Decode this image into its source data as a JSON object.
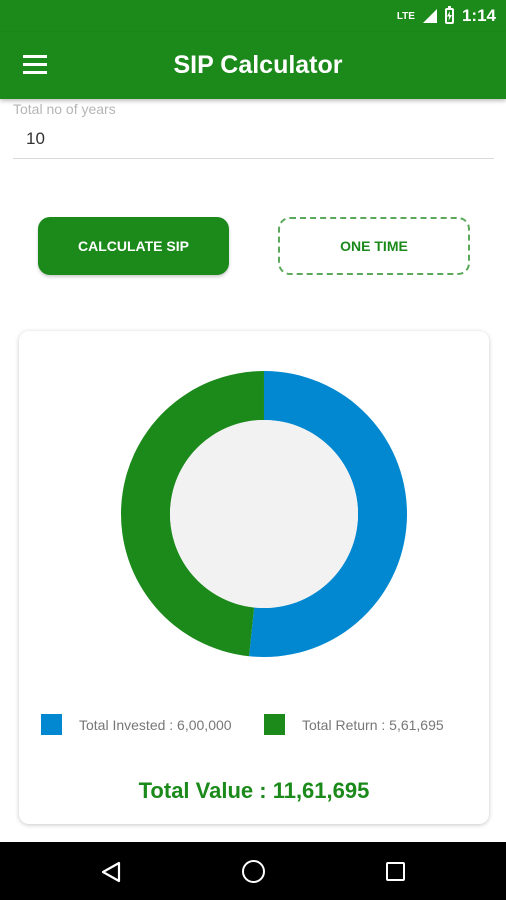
{
  "status_bar": {
    "network": "LTE",
    "time": "1:14",
    "icons": [
      "signal-icon",
      "battery-charging-icon"
    ]
  },
  "app_bar": {
    "title": "SIP Calculator",
    "menu_icon": "menu-icon"
  },
  "form": {
    "years_label": "Total no of years",
    "years_value": "10"
  },
  "buttons": {
    "calculate_sip": "CALCULATE SIP",
    "one_time": "ONE TIME"
  },
  "result": {
    "invested_fraction": 0.5167,
    "return_fraction": 0.4833,
    "legend": [
      {
        "label": "Total Invested : 6,00,000",
        "color": "#0288d1"
      },
      {
        "label": "Total Return : 5,61,695",
        "color": "#1b8a1b"
      }
    ],
    "total_value": "Total Value : 11,61,695"
  },
  "colors": {
    "primary": "#1b8a1b",
    "invested": "#0288d1",
    "returns": "#1b8a1b",
    "donut_center": "#f2f2f2"
  },
  "nav": {
    "icons": [
      "back-icon",
      "home-icon",
      "recent-apps-icon"
    ]
  }
}
